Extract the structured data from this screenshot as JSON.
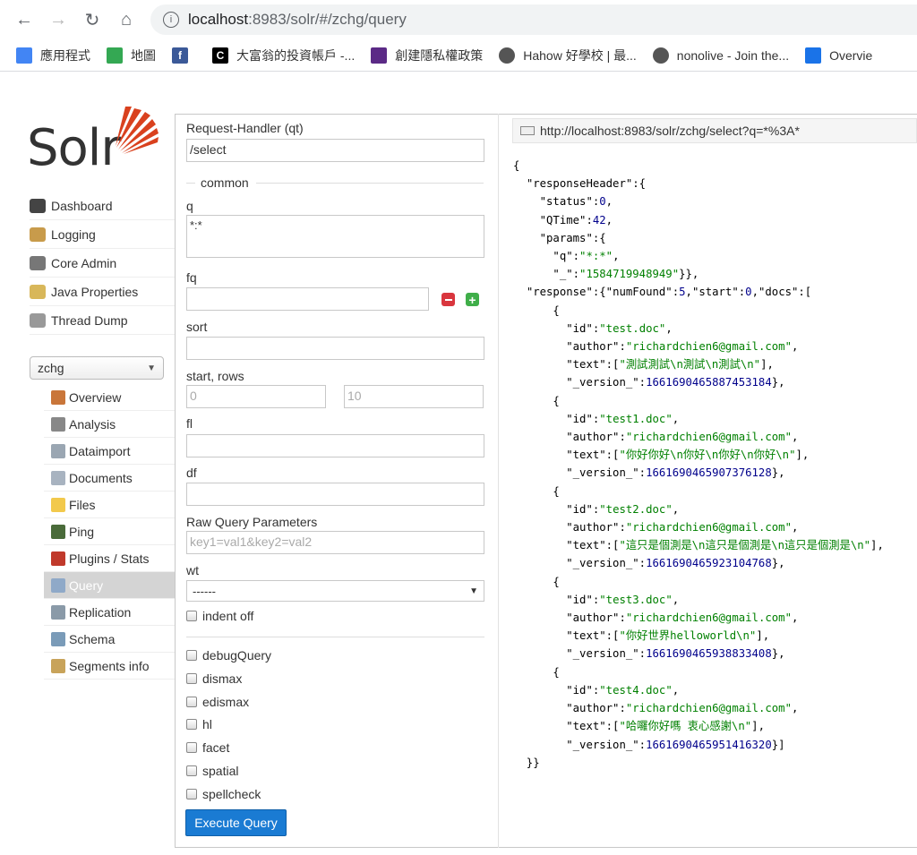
{
  "browser": {
    "url_host": "localhost",
    "url_path": ":8983/solr/#/zchg/query",
    "bookmarks": [
      {
        "icon": "apps-grid-icon",
        "label": "應用程式",
        "color": "#4285f4"
      },
      {
        "icon": "maps-pin-icon",
        "label": "地圖",
        "color": "#34a853"
      },
      {
        "icon": "facebook-icon",
        "label": "",
        "color": "#3b5998"
      },
      {
        "icon": "c-logo-icon",
        "label": "大富翁的投資帳戶 -...",
        "color": "#000000"
      },
      {
        "icon": "shield-icon",
        "label": "創建隱私權政策",
        "color": "#5b2a86"
      },
      {
        "icon": "globe-icon",
        "label": "Hahow 好學校 | 最...",
        "color": "#555555"
      },
      {
        "icon": "globe-icon",
        "label": "nonolive - Join the...",
        "color": "#555555"
      },
      {
        "icon": "bookmark-blue-icon",
        "label": "Overvie",
        "color": "#1a73e8"
      }
    ]
  },
  "logo": {
    "text": "Solr"
  },
  "main_nav": [
    {
      "icon": "dashboard-icon",
      "label": "Dashboard",
      "color": "#444444"
    },
    {
      "icon": "logging-icon",
      "label": "Logging",
      "color": "#c89b4b"
    },
    {
      "icon": "core-admin-icon",
      "label": "Core Admin",
      "color": "#777777"
    },
    {
      "icon": "java-icon",
      "label": "Java Properties",
      "color": "#d8b75a"
    },
    {
      "icon": "thread-dump-icon",
      "label": "Thread Dump",
      "color": "#999999"
    }
  ],
  "core_select": {
    "value": "zchg"
  },
  "core_nav": [
    {
      "icon": "overview-icon",
      "label": "Overview",
      "color": "#c9763a"
    },
    {
      "icon": "analysis-icon",
      "label": "Analysis",
      "color": "#888888"
    },
    {
      "icon": "dataimport-icon",
      "label": "Dataimport",
      "color": "#9aa6b2"
    },
    {
      "icon": "documents-icon",
      "label": "Documents",
      "color": "#a8b3c0"
    },
    {
      "icon": "files-icon",
      "label": "Files",
      "color": "#f2c94c"
    },
    {
      "icon": "ping-icon",
      "label": "Ping",
      "color": "#4a6b3a"
    },
    {
      "icon": "plugins-icon",
      "label": "Plugins / Stats",
      "color": "#c0392b"
    },
    {
      "icon": "query-icon",
      "label": "Query",
      "color": "#8fa9c8",
      "active": true
    },
    {
      "icon": "replication-icon",
      "label": "Replication",
      "color": "#8a9aa8"
    },
    {
      "icon": "schema-icon",
      "label": "Schema",
      "color": "#7a9bb8"
    },
    {
      "icon": "segments-icon",
      "label": "Segments info",
      "color": "#c8a35a"
    }
  ],
  "form": {
    "qt_label": "Request-Handler (qt)",
    "qt_value": "/select",
    "common_label": "common",
    "q_label": "q",
    "q_value": "*:*",
    "fq_label": "fq",
    "fq_value": "",
    "sort_label": "sort",
    "sort_value": "",
    "startrows_label": "start, rows",
    "start_placeholder": "0",
    "rows_placeholder": "10",
    "fl_label": "fl",
    "df_label": "df",
    "raw_label": "Raw Query Parameters",
    "raw_placeholder": "key1=val1&key2=val2",
    "wt_label": "wt",
    "wt_value": "------",
    "indent_label": "indent off",
    "checkboxes": [
      "debugQuery",
      "dismax",
      "edismax",
      "hl",
      "facet",
      "spatial",
      "spellcheck"
    ],
    "execute_label": "Execute Query"
  },
  "result": {
    "url": "http://localhost:8983/solr/zchg/select?q=*%3A*",
    "status": "0",
    "qtime": "42",
    "param_q": "*:*",
    "param_underscore": "1584719948949",
    "num_found": "5",
    "start": "0",
    "docs": [
      {
        "id": "test.doc",
        "author": "richardchien6@gmail.com",
        "text": "測試測試\\n測試\\n測試\\n",
        "version": "1661690465887453184"
      },
      {
        "id": "test1.doc",
        "author": "richardchien6@gmail.com",
        "text": "你好你好\\n你好\\n你好\\n你好\\n",
        "version": "1661690465907376128"
      },
      {
        "id": "test2.doc",
        "author": "richardchien6@gmail.com",
        "text": "這只是個測是\\n這只是個測是\\n這只是個測是\\n",
        "version": "1661690465923104768"
      },
      {
        "id": "test3.doc",
        "author": "richardchien6@gmail.com",
        "text": "你好世界helloworld\\n",
        "version": "1661690465938833408"
      },
      {
        "id": "test4.doc",
        "author": "richardchien6@gmail.com",
        "text": "哈囉你好嗎 衷心感謝\\n",
        "version": "1661690465951416320"
      }
    ]
  }
}
